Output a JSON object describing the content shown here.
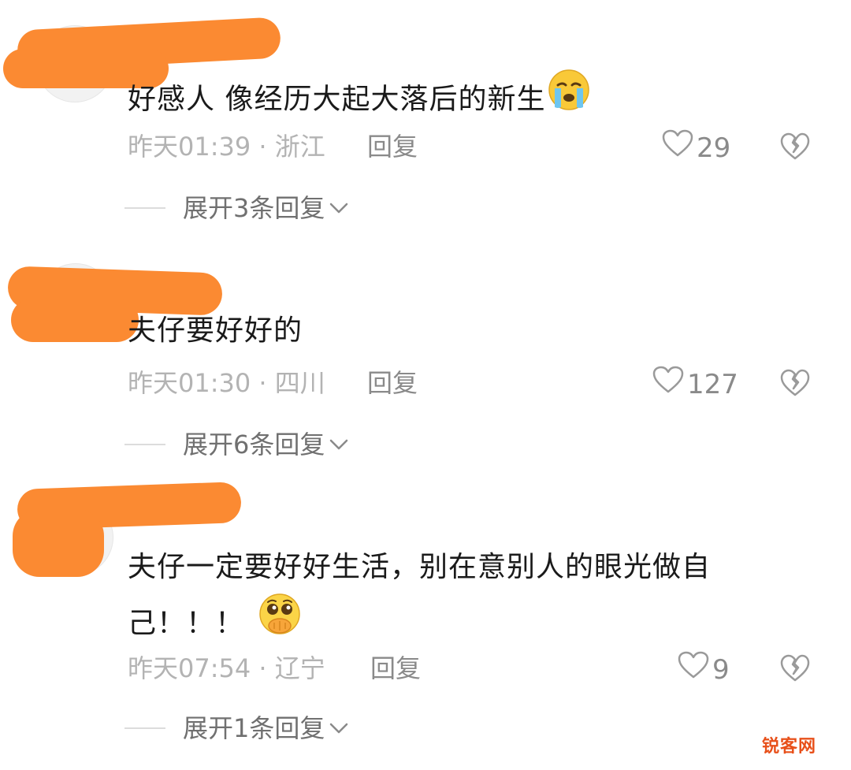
{
  "comments": [
    {
      "text": "好感人 像经历大起大落后的新生",
      "emoji": "loudly-crying-face",
      "meta": "昨天01:39 · 浙江",
      "reply_label": "回复",
      "likes": "29",
      "expand_label": "展开3条回复"
    },
    {
      "text": "夫仔要好好的",
      "meta": "昨天01:30 · 四川",
      "reply_label": "回复",
      "likes": "127",
      "expand_label": "展开6条回复"
    },
    {
      "text_line1": "夫仔一定要好好生活，别在意别人的眼光做自",
      "text_line2": "己！！！",
      "emoji": "pleading-face-covering-mouth",
      "meta": "昨天07:54 · 辽宁",
      "reply_label": "回复",
      "likes": "9",
      "expand_label": "展开1条回复"
    }
  ],
  "watermark": "锐客网",
  "colors": {
    "redaction": "#fb8a32",
    "meta_text": "#b3b3b3",
    "watermark": "#e8501a"
  }
}
